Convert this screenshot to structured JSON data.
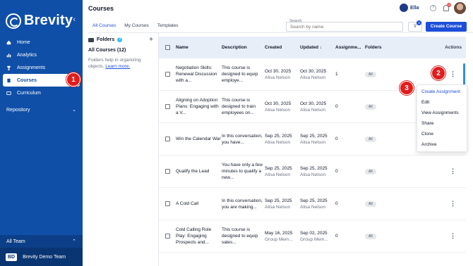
{
  "sidebar": {
    "logo_text": "Brevity",
    "collapse_icon": "chevron-left-icon",
    "items": [
      {
        "label": "Home",
        "icon": "home-icon"
      },
      {
        "label": "Analytics",
        "icon": "bar-chart-icon"
      },
      {
        "label": "Assignments",
        "icon": "trophy-icon"
      },
      {
        "label": "Courses",
        "icon": "book-icon",
        "active": true
      },
      {
        "label": "Curriculum",
        "icon": "curriculum-icon"
      }
    ],
    "repository": "Repository",
    "team_label": "All Team",
    "team_avatar": "BD",
    "team_name": "Brevity Demo Team"
  },
  "header": {
    "title": "Courses",
    "user_name": "Ella",
    "help": "?",
    "notifications_count": "10"
  },
  "tabs": [
    "All Courses",
    "My Courses",
    "Templates"
  ],
  "search": {
    "label": "Search",
    "placeholder": "Search by name"
  },
  "filter": {
    "badge": "3"
  },
  "create_button": "Create Course",
  "folders": {
    "title": "Folders",
    "info": "?",
    "add": "+",
    "all": "All Courses  (12)",
    "help_text": "Folders help in organizing objects.",
    "learn_more": "Learn more."
  },
  "table": {
    "headers": {
      "name": "Name",
      "description": "Description",
      "created": "Created",
      "updated": "Updated ↓",
      "assignments": "Assignme...",
      "folders": "Folders",
      "actions": "Actions"
    },
    "rows": [
      {
        "name": "Negotiation Skills: Renewal Discussion with a...",
        "desc": "This course is designed to equip employe...",
        "created_date": "Oct 30, 2025",
        "created_by": "Alisa Nelson",
        "updated_date": "Oct 30, 2025",
        "updated_by": "Alisa Nelson",
        "assignments": "1",
        "folder": "All"
      },
      {
        "name": "Aligning on Adoption Plans: Engaging with a V...",
        "desc": "This course is designed to train employees on...",
        "created_date": "Oct 30, 2025",
        "created_by": "Alisa Nelson",
        "updated_date": "Oct 30, 2025",
        "updated_by": "Alisa Nelson",
        "assignments": "0",
        "folder": "All"
      },
      {
        "name": "Win the Calendar War",
        "desc": "In this conversation, you have...",
        "created_date": "Sep 25, 2025",
        "created_by": "Alisa Nelson",
        "updated_date": "Sep 25, 2025",
        "updated_by": "Alisa Nelson",
        "assignments": "0",
        "folder": "All"
      },
      {
        "name": "Qualify the Lead",
        "desc": "You have only a few minutes to qualify a new...",
        "created_date": "Sep 25, 2025",
        "created_by": "Alisa Nelson",
        "updated_date": "Sep 25, 2025",
        "updated_by": "Alisa Nelson",
        "assignments": "0",
        "folder": "All"
      },
      {
        "name": "A Cold Call",
        "desc": "In this conversation, you are making...",
        "created_date": "Sep 25, 2025",
        "created_by": "Alisa Nelson",
        "updated_date": "Sep 25, 2025",
        "updated_by": "Alisa Nelson",
        "assignments": "0",
        "folder": "All"
      },
      {
        "name": "Cold Calling Role Play: Engaging Prospects and...",
        "desc": "This course is designed to equip sales...",
        "created_date": "May 16, 2025",
        "created_by": "Group Mem...",
        "updated_date": "Sep 02, 2025",
        "updated_by": "Group Mem...",
        "assignments": "0",
        "folder": "All"
      }
    ],
    "row_action_icon": "more-vertical-icon"
  },
  "menu": [
    "Create Assignment",
    "Edit",
    "View Assignments",
    "Share",
    "Clone",
    "Archive"
  ],
  "steps": [
    "1",
    "2",
    "3"
  ],
  "colors": {
    "sidebar": "#0f4fa8",
    "accent": "#1d4ed8",
    "step": "#e11d1d"
  }
}
